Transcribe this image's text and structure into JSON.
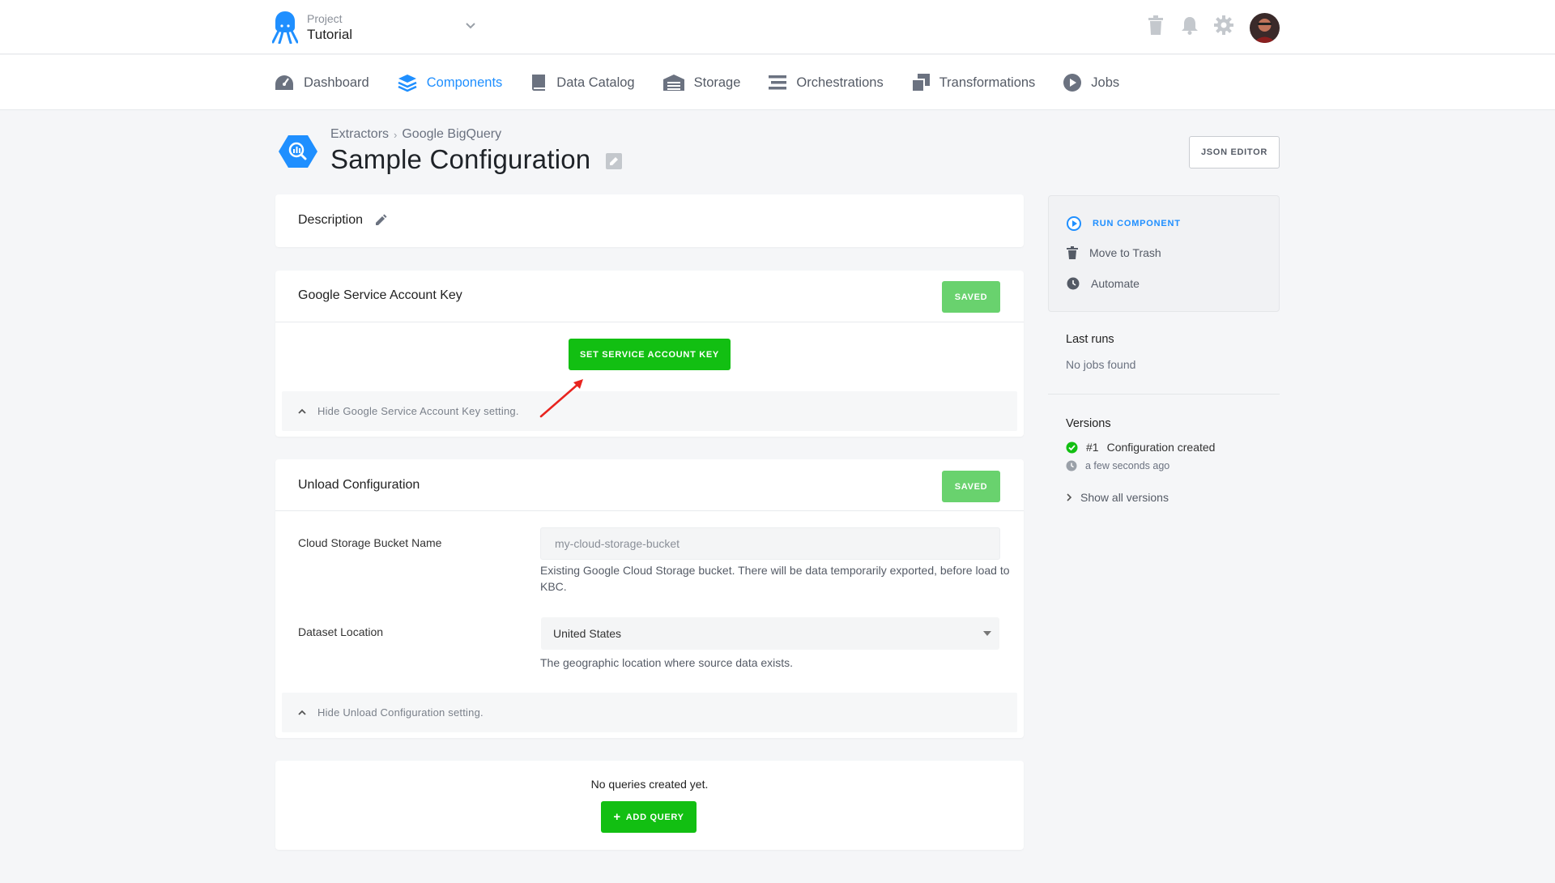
{
  "header": {
    "project_label": "Project",
    "project_name": "Tutorial",
    "icons": [
      "trash-icon",
      "bell-icon",
      "gear-icon"
    ]
  },
  "nav": {
    "items": [
      {
        "label": "Dashboard",
        "icon": "dashboard-icon",
        "active": false
      },
      {
        "label": "Components",
        "icon": "components-icon",
        "active": true
      },
      {
        "label": "Data Catalog",
        "icon": "book-icon",
        "active": false
      },
      {
        "label": "Storage",
        "icon": "storage-icon",
        "active": false
      },
      {
        "label": "Orchestrations",
        "icon": "orchestrations-icon",
        "active": false
      },
      {
        "label": "Transformations",
        "icon": "transformations-icon",
        "active": false
      },
      {
        "label": "Jobs",
        "icon": "play-icon",
        "active": false
      }
    ],
    "active_color": "#1f8fff"
  },
  "page": {
    "breadcrumb_parent": "Extractors",
    "breadcrumb_current": "Google BigQuery",
    "title": "Sample Configuration",
    "json_editor_label": "JSON EDITOR"
  },
  "description": {
    "title": "Description"
  },
  "service_account": {
    "title": "Google Service Account Key",
    "saved_label": "SAVED",
    "set_key_label": "SET SERVICE ACCOUNT KEY",
    "hide_label": "Hide Google Service Account Key setting."
  },
  "unload": {
    "title": "Unload Configuration",
    "saved_label": "SAVED",
    "bucket_label": "Cloud Storage Bucket Name",
    "bucket_placeholder": "my-cloud-storage-bucket",
    "bucket_help": "Existing Google Cloud Storage bucket. There will be data temporarily exported, before load to KBC.",
    "location_label": "Dataset Location",
    "location_value": "United States",
    "location_help": "The geographic location where source data exists.",
    "hide_label": "Hide Unload Configuration setting."
  },
  "queries": {
    "empty_text": "No queries created yet.",
    "add_label": "ADD QUERY"
  },
  "sidebar": {
    "run_label": "RUN COMPONENT",
    "trash_label": "Move to Trash",
    "automate_label": "Automate",
    "last_runs_title": "Last runs",
    "last_runs_empty": "No jobs found",
    "versions_title": "Versions",
    "version_number": "#1",
    "version_desc": "Configuration created",
    "version_time": "a few seconds ago",
    "show_all_label": "Show all versions"
  },
  "colors": {
    "saved_green": "#69d26e",
    "action_green": "#12bf12",
    "accent_blue": "#1f8fff"
  }
}
